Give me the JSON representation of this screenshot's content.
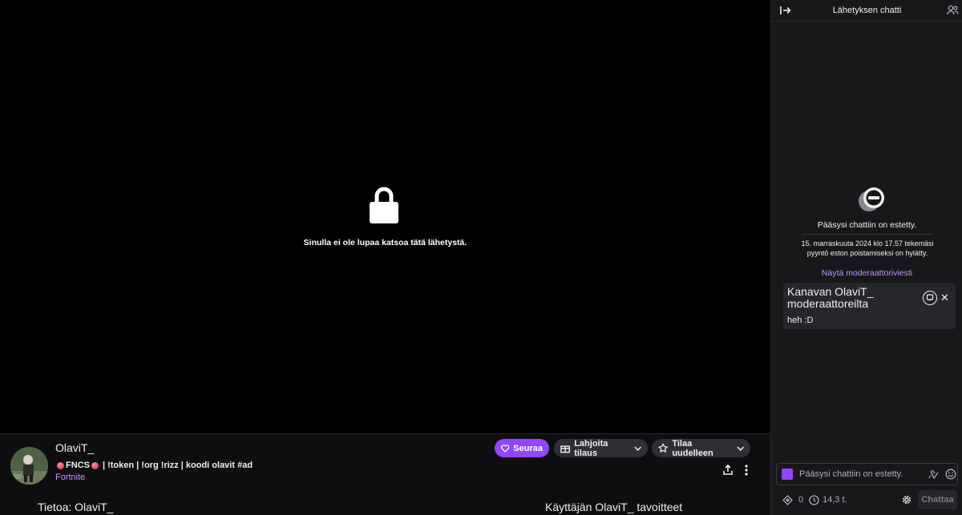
{
  "player": {
    "blocked_message": "Sinulla ei ole lupaa katsoa tätä lähetystä."
  },
  "channel": {
    "name": "OlaviT_",
    "title_prefix": "FNCS",
    "title_rest": "| !token | !org !rizz | koodi olavit #ad",
    "category": "Fortnite",
    "follow_label": "Seuraa",
    "gift_label": "Lahjoita tilaus",
    "resub_label": "Tilaa uudelleen",
    "about_label": "Tietoa: OlaviT_",
    "goals_label": "Käyttäjän OlaviT_ tavoitteet"
  },
  "chat": {
    "header_title": "Lähetyksen chatti",
    "ban_title": "Pääsysi chattiin on estetty.",
    "ban_detail": "15. marraskuuta 2024 klo 17.57 tekemäsi pyyntö eston poistamiseksi on hylätty.",
    "mod_link": "Näytä moderaattoriviesti",
    "mod_card": {
      "title": "Kanavan OlaviT_ moderaattoreilta",
      "message": "heh :D"
    },
    "input_placeholder": "Pääsysi chattiin on estetty.",
    "points_count": "0",
    "watch_time": "14,3 t.",
    "send_label": "Chattaa"
  },
  "colors": {
    "accent": "#9147ff",
    "link": "#bf94ff",
    "background": "#0e0e10",
    "chat_background": "#18181b"
  }
}
